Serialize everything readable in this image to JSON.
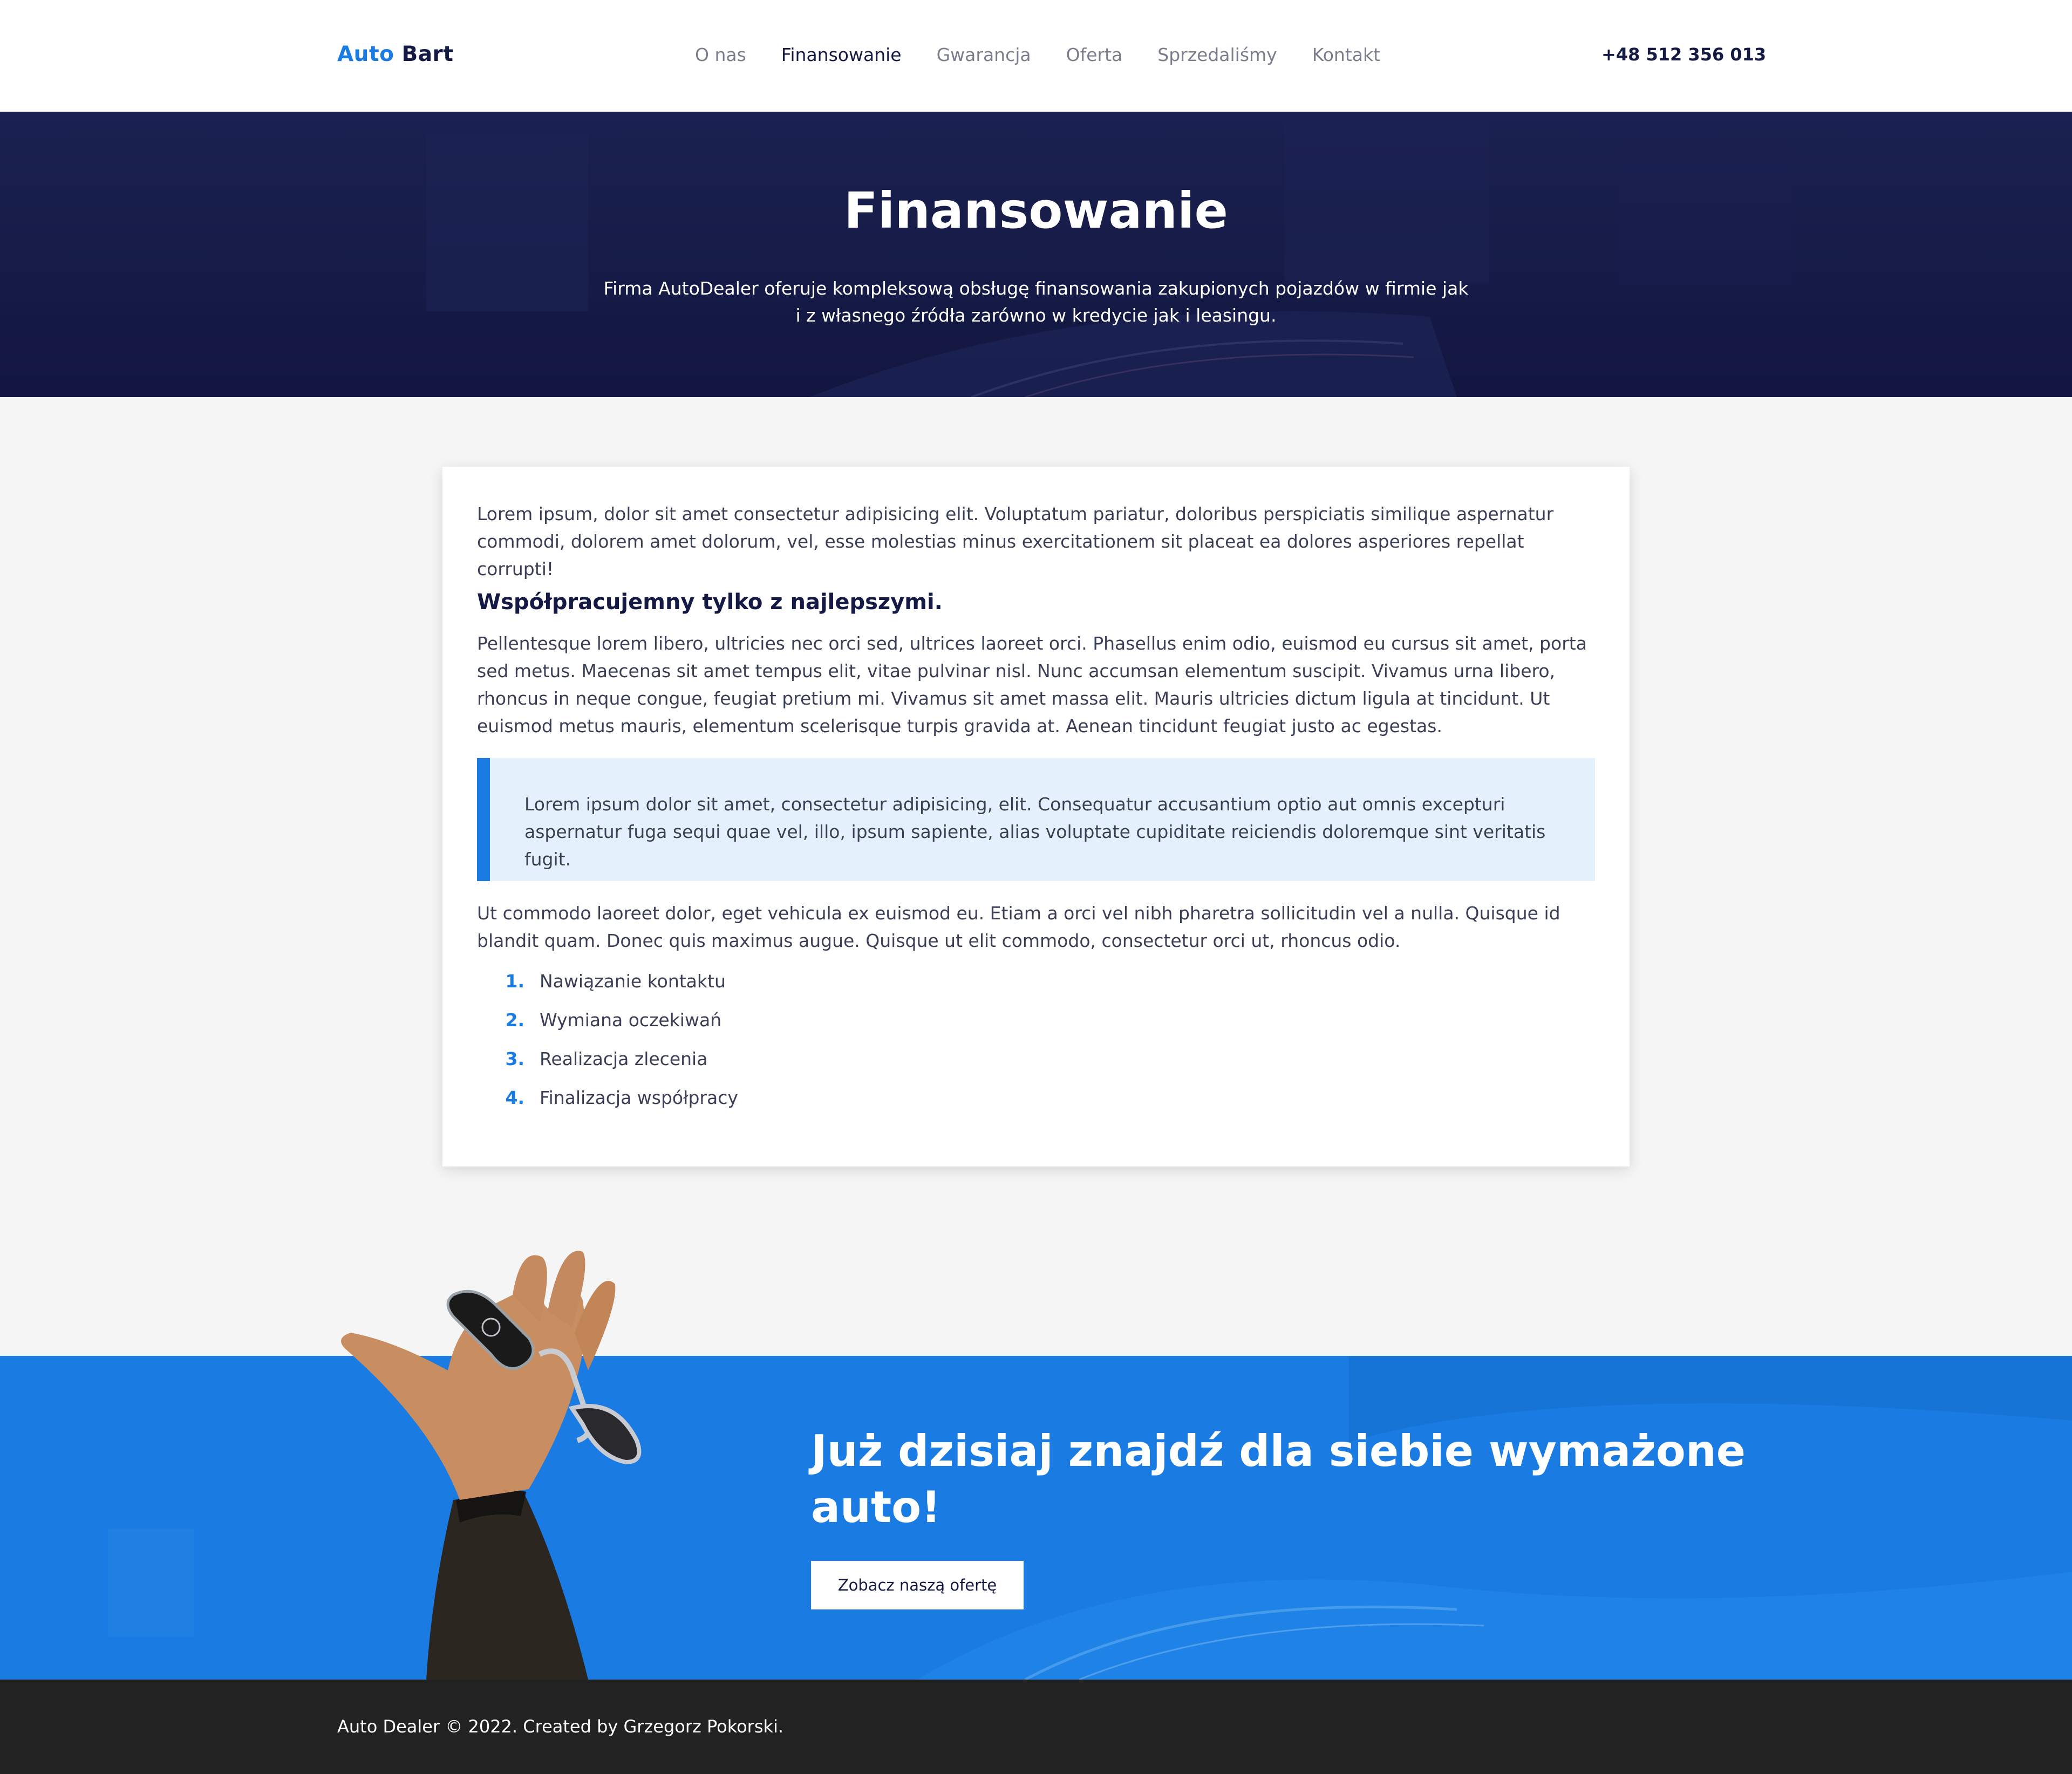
{
  "header": {
    "logo_part1": "Auto",
    "logo_part2": "Bart",
    "nav": [
      "O nas",
      "Finansowanie",
      "Gwarancja",
      "Oferta",
      "Sprzedaliśmy",
      "Kontakt"
    ],
    "active_nav": "Finansowanie",
    "phone": "+48 512 356 013"
  },
  "hero": {
    "title": "Finansowanie",
    "subtitle": "Firma AutoDealer oferuje kompleksową obsługę finansowania zakupionych pojazdów w firmie jak i z własnego źródła zarówno w kredycie jak i leasingu."
  },
  "content": {
    "intro": "Lorem ipsum, dolor sit amet consectetur adipisicing elit. Voluptatum pariatur, doloribus perspiciatis similique aspernatur commodi, dolorem amet dolorum, vel, esse molestias minus exercitationem sit placeat ea dolores asperiores repellat corrupti!",
    "heading": "Współpracujemny tylko z najlepszymi.",
    "paragraph": "Pellentesque lorem libero, ultricies nec orci sed, ultrices laoreet orci. Phasellus enim odio, euismod eu cursus sit amet, porta sed metus. Maecenas sit amet tempus elit, vitae pulvinar nisl. Nunc accumsan elementum suscipit. Vivamus urna libero, rhoncus in neque congue, feugiat pretium mi. Vivamus sit amet massa elit. Mauris ultricies dictum ligula at tincidunt. Ut euismod metus mauris, elementum scelerisque turpis gravida at. Aenean tincidunt feugiat justo ac egestas.",
    "quote": "Lorem ipsum dolor sit amet, consectetur adipisicing, elit. Consequatur accusantium optio aut omnis excepturi aspernatur fuga sequi quae vel, illo, ipsum sapiente, alias voluptate cupiditate reiciendis doloremque sint veritatis fugit.",
    "paragraph2": "Ut commodo laoreet dolor, eget vehicula ex euismod eu. Etiam a orci vel nibh pharetra sollicitudin vel a nulla. Quisque id blandit quam. Donec quis maximus augue. Quisque ut elit commodo, consectetur orci ut, rhoncus odio.",
    "steps": [
      {
        "num": "1.",
        "label": "Nawiązanie kontaktu"
      },
      {
        "num": "2.",
        "label": "Wymiana oczekiwań"
      },
      {
        "num": "3.",
        "label": "Realizacja zlecenia"
      },
      {
        "num": "4.",
        "label": "Finalizacja współpracy"
      }
    ]
  },
  "cta": {
    "title": "Już dzisiaj znajdź dla siebie wymażone auto!",
    "button": "Zobacz naszą ofertę"
  },
  "footer": {
    "text": "Auto Dealer © 2022. Created by Grzegorz Pokorski."
  },
  "colors": {
    "accent": "#1a7be2",
    "navy": "#151a45",
    "quote_bg": "#e4f1fc",
    "footer_bg": "#222222"
  }
}
